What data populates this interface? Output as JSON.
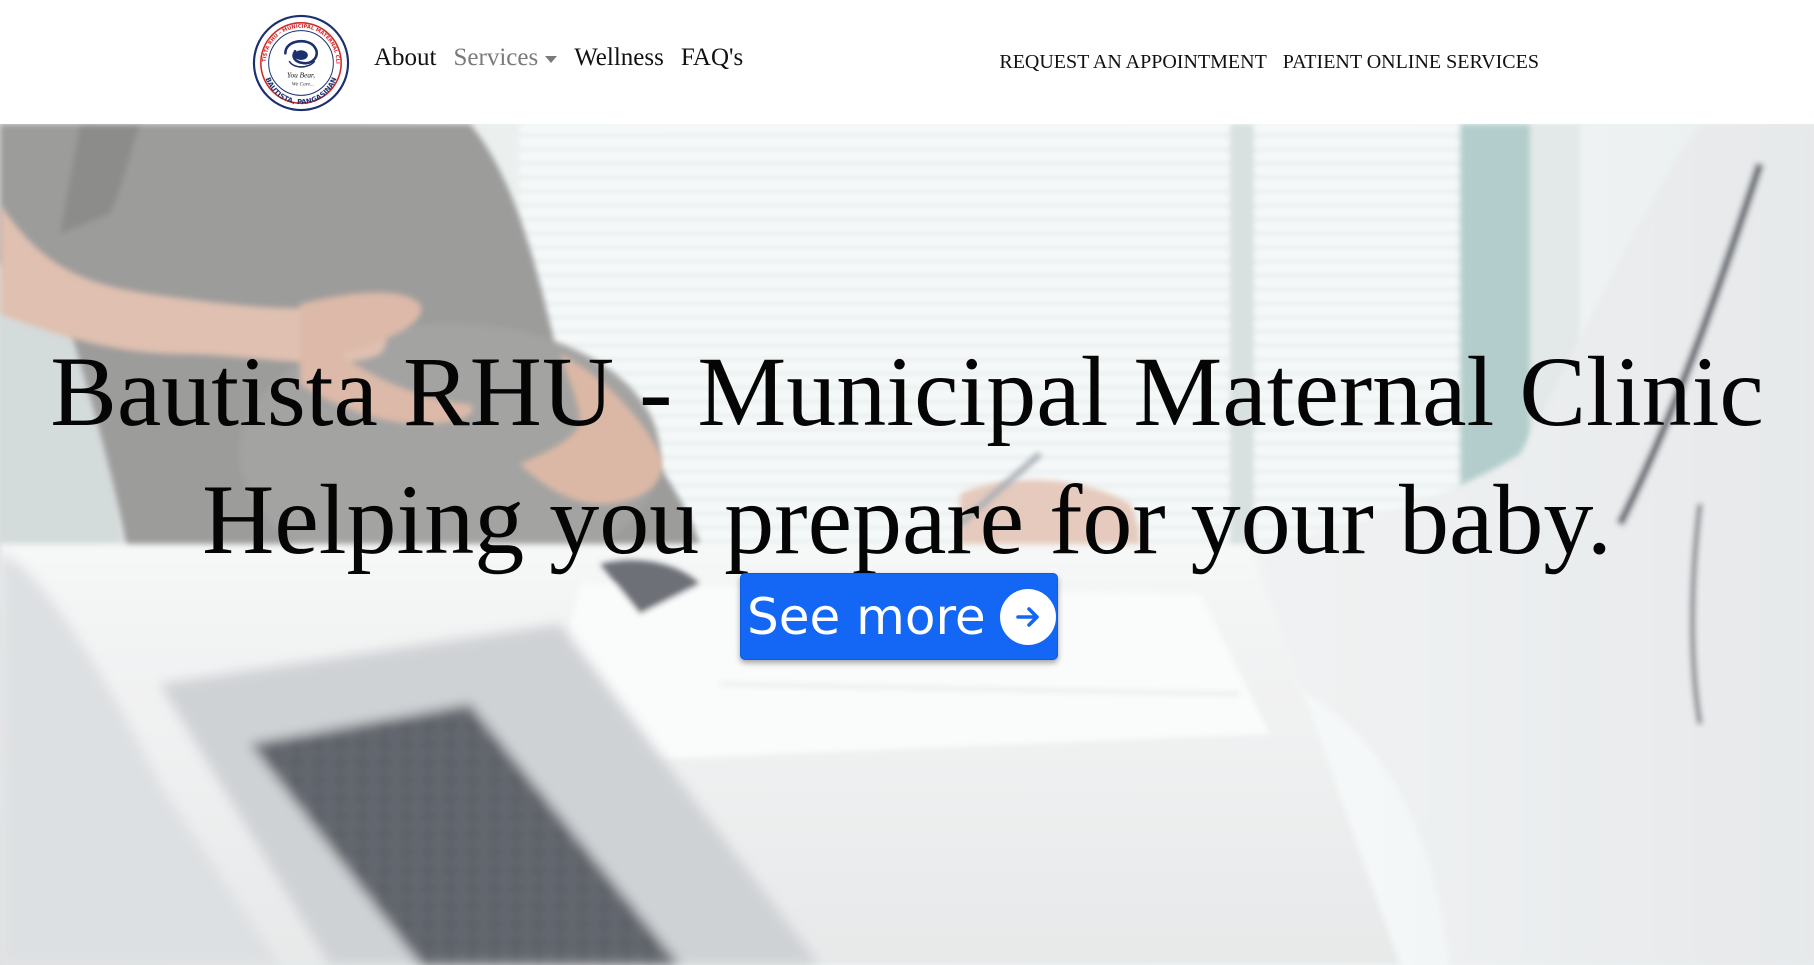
{
  "nav": {
    "logo": {
      "ring_text_top": "BAUTISTA RHU - MUNICIPAL MATERNAL CLINIC",
      "tagline_1": "You Bear,",
      "tagline_2": "We Care...",
      "ring_text_bottom": "BAUTISTA, PANGASINAN"
    },
    "links": {
      "about": "About",
      "services": "Services",
      "wellness": "Wellness",
      "faq": "FAQ's"
    },
    "right_links": {
      "appointment": "REQUEST AN APPOINTMENT",
      "patient_services": "PATIENT ONLINE SERVICES"
    }
  },
  "hero": {
    "title_line1": "Bautista RHU - Municipal Maternal Clinic",
    "title_line2": "Helping you prepare for your baby.",
    "cta_label": "See more",
    "cta_icon": "arrow-right-circle-icon"
  },
  "colors": {
    "primary_button": "#1467f5",
    "text_dark": "#050505",
    "nav_muted": "#7a7a7a",
    "logo_red": "#d32a2a",
    "logo_navy": "#1c2f6e"
  }
}
